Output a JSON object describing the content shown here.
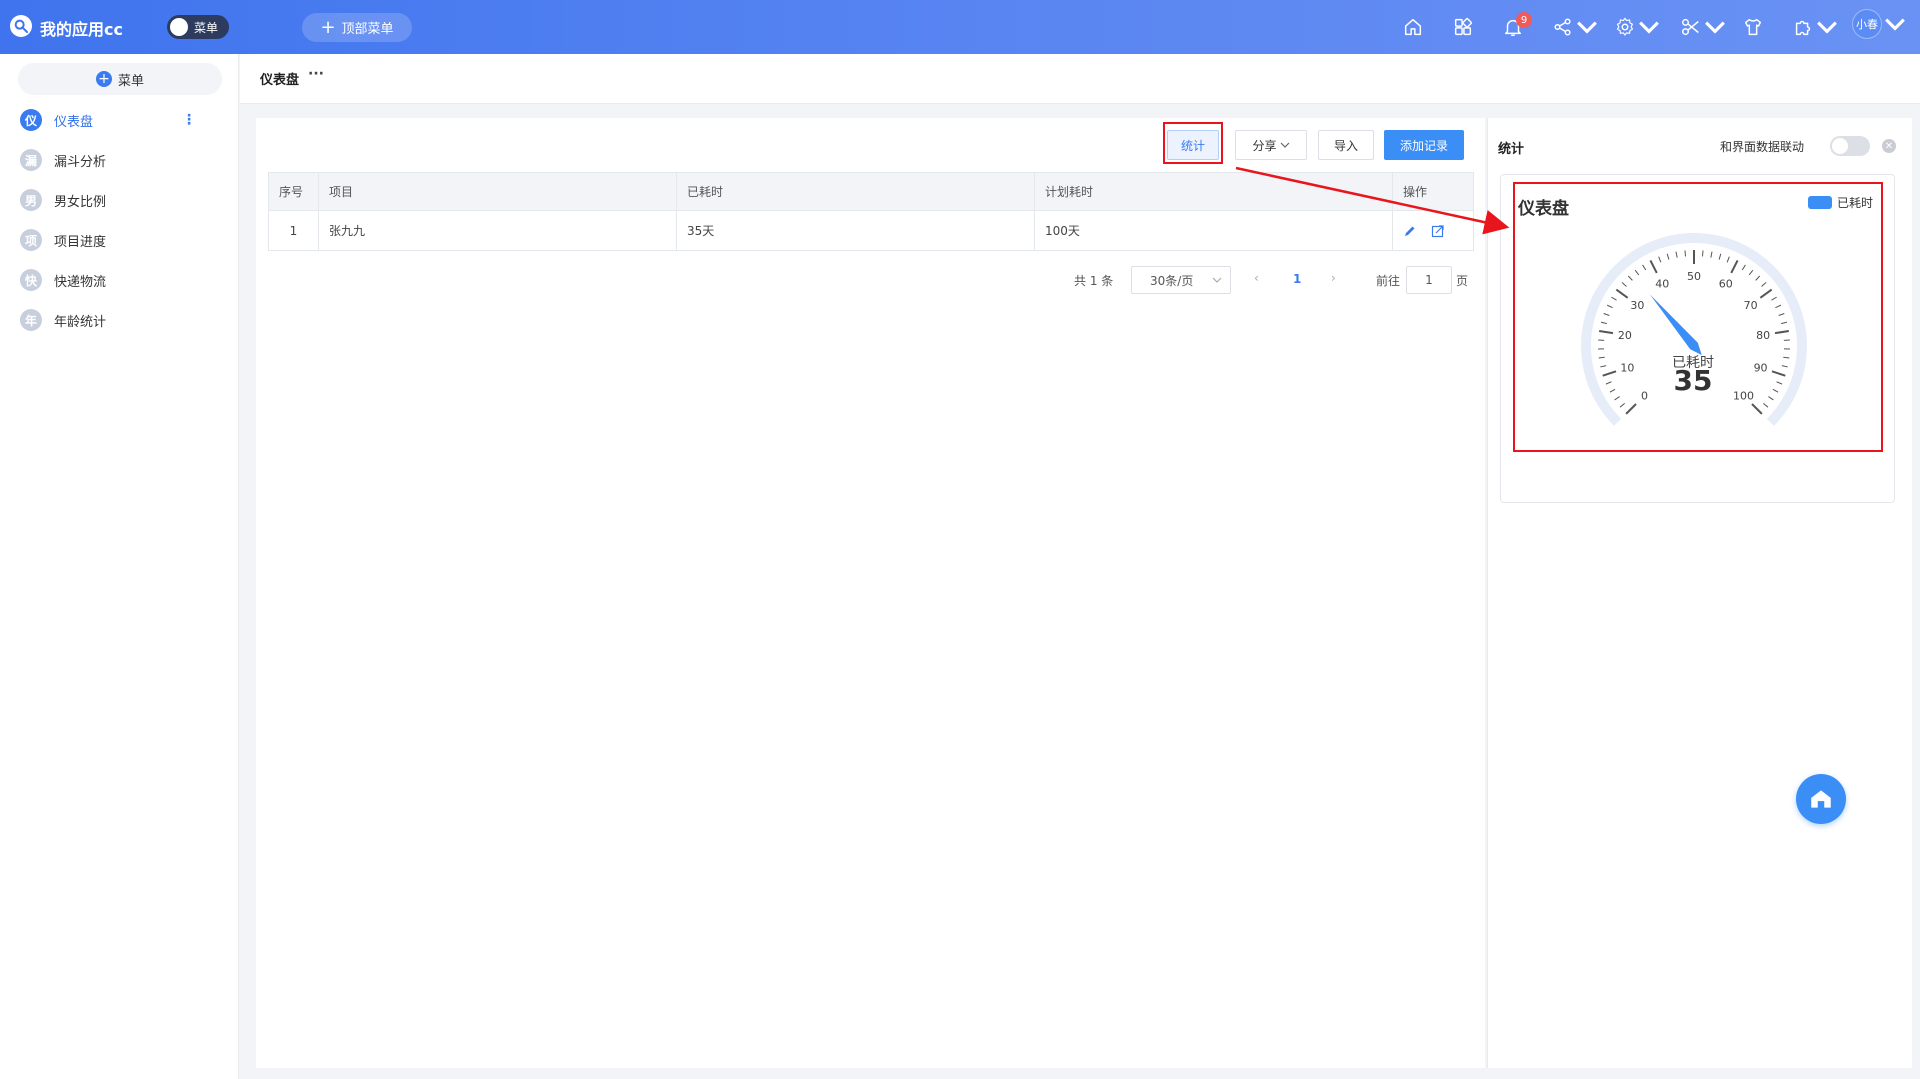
{
  "app": {
    "title": "我的应用cc",
    "menu_toggle_label": "菜单",
    "top_menu_label": "顶部菜单"
  },
  "topbar": {
    "notification_count": "9",
    "user_name": "小春"
  },
  "sidebar": {
    "add_label": "菜单",
    "items": [
      {
        "icon_char": "仪",
        "label": "仪表盘",
        "active": true
      },
      {
        "icon_char": "漏",
        "label": "漏斗分析"
      },
      {
        "icon_char": "男",
        "label": "男女比例"
      },
      {
        "icon_char": "项",
        "label": "项目进度"
      },
      {
        "icon_char": "快",
        "label": "快递物流"
      },
      {
        "icon_char": "年",
        "label": "年龄统计"
      }
    ]
  },
  "breadcrumb": {
    "title": "仪表盘",
    "more": "···"
  },
  "toolbar": {
    "stat_label": "统计",
    "share_label": "分享",
    "import_label": "导入",
    "add_label": "添加记录"
  },
  "table": {
    "headers": [
      "序号",
      "项目",
      "已耗时",
      "计划耗时",
      "操作"
    ],
    "rows": [
      {
        "index": "1",
        "project": "张九九",
        "elapsed": "35天",
        "planned": "100天"
      }
    ]
  },
  "pager": {
    "total": "共 1 条",
    "page_size": "30条/页",
    "current": "1",
    "goto_label": "前往",
    "goto_value": "1",
    "page_unit": "页"
  },
  "stats_panel": {
    "title": "统计",
    "link_label": "和界面数据联动"
  },
  "chart_data": {
    "type": "gauge",
    "title": "仪表盘",
    "series": [
      {
        "name": "已耗时",
        "value": 35
      }
    ],
    "min": 0,
    "max": 100,
    "tick_labels": [
      "0",
      "10",
      "20",
      "30",
      "40",
      "50",
      "60",
      "70",
      "80",
      "90",
      "100"
    ],
    "value_label": "35",
    "color": "#3a8ef6"
  },
  "colors": {
    "accent": "#3a7cf0",
    "highlight": "#e8151d"
  }
}
